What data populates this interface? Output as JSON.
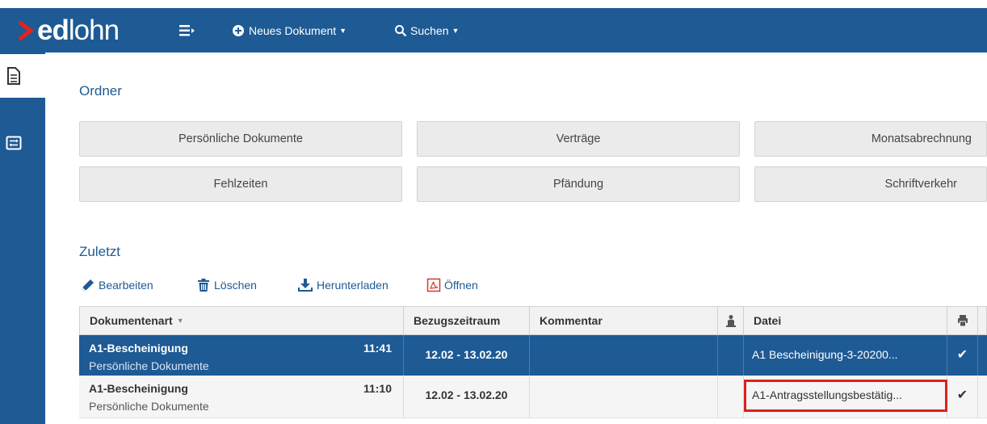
{
  "header": {
    "logo_bold": "ed",
    "logo_light": "lohn",
    "new_document_label": "Neues Dokument",
    "search_label": "Suchen"
  },
  "folders": {
    "title": "Ordner",
    "items": [
      {
        "label": "Persönliche Dokumente"
      },
      {
        "label": "Verträge"
      },
      {
        "label": "Monatsabrechnung"
      },
      {
        "label": "Fehlzeiten"
      },
      {
        "label": "Pfändung"
      },
      {
        "label": "Schriftverkehr"
      }
    ]
  },
  "recent": {
    "title": "Zuletzt",
    "toolbar": {
      "edit_label": "Bearbeiten",
      "delete_label": "Löschen",
      "download_label": "Herunterladen",
      "open_label": "Öffnen"
    },
    "columns": {
      "document_type": "Dokumentenart",
      "period": "Bezugszeitraum",
      "comment": "Kommentar",
      "file": "Datei"
    },
    "rows": [
      {
        "document_type": "A1-Bescheinigung",
        "time": "11:41",
        "folder": "Persönliche Dokumente",
        "period": "12.02 - 13.02.20",
        "comment": "",
        "file": "A1 Bescheinigung-3-20200...",
        "selected": true
      },
      {
        "document_type": "A1-Bescheinigung",
        "time": "11:10",
        "folder": "Persönliche Dokumente",
        "period": "12.02 - 13.02.20",
        "comment": "",
        "file": "A1-Antragsstellungsbestätig...",
        "selected": false
      }
    ]
  },
  "colors": {
    "brand_blue": "#1e5a94",
    "logo_red": "#e2231a",
    "highlight_red": "#e0201c",
    "pdf_icon": "#d9362b"
  },
  "icons": {
    "sidebar_documents": "document-icon",
    "sidebar_folders": "folder-list-icon",
    "menu": "menu-icon",
    "new": "plus-circle-icon",
    "search": "search-icon",
    "edit": "pencil-icon",
    "delete": "trash-icon",
    "download": "download-icon",
    "open": "pdf-icon",
    "sort": "sort-down-icon",
    "attachment_column": "person-icon",
    "print_column": "printer-icon",
    "check": "check-icon"
  }
}
